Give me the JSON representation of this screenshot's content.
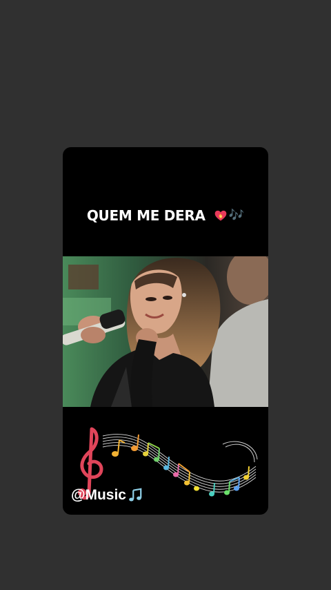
{
  "story": {
    "title": "QUEM ME DERA",
    "title_emojis": [
      "heart-on-fire-icon",
      "musical-notes-icon"
    ],
    "notes_glyph": "🎶",
    "handle": "@Music",
    "handle_icon": "musical-note-icon"
  },
  "colors": {
    "page_background": "#303030",
    "card_background": "#000000",
    "title_color": "#ffffff",
    "notes_color": "#9fd6d2",
    "heart_color": "#e8395a"
  }
}
